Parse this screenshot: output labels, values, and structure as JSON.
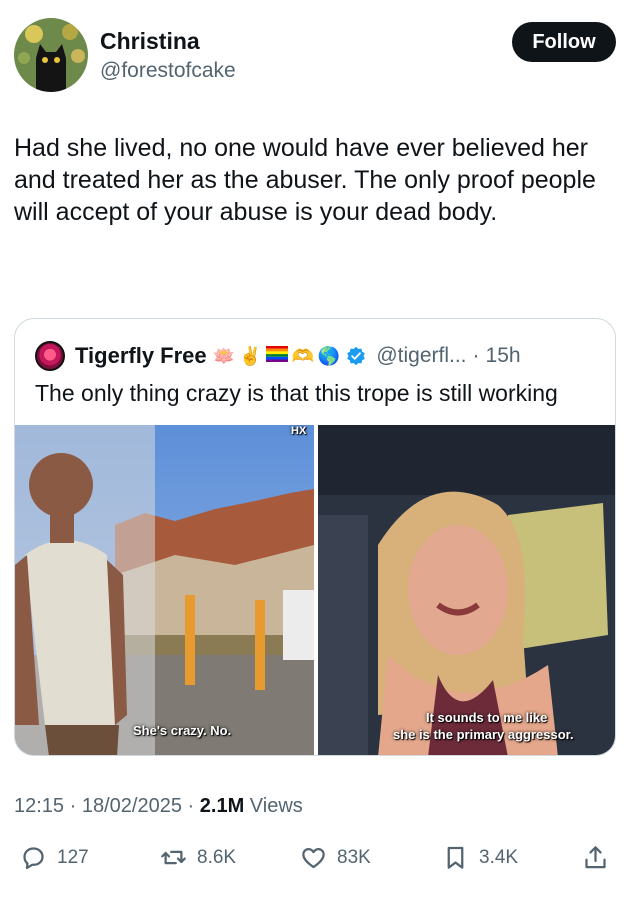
{
  "author": {
    "name": "Christina",
    "handle": "@forestofcake",
    "follow_label": "Follow"
  },
  "tweet": {
    "text": "Had she lived, no one would have ever believed her and treated her as the abuser. The only proof people will accept of your abuse is your dead body."
  },
  "quoted": {
    "name": "Tigerfly Free",
    "emojis": [
      "lotus-emoji",
      "victory-hand-emoji",
      "rainbow-flag-emoji",
      "heart-hands-emoji",
      "globe-emoji"
    ],
    "handle": "@tigerfl...",
    "separator": "·",
    "time": "15h",
    "text": "The only thing crazy is that this trope is still working",
    "media": [
      {
        "caption": "She's crazy. No.",
        "watermark": "HX"
      },
      {
        "caption_line1": "It sounds to me like",
        "caption_line2": "she is the primary aggressor."
      }
    ]
  },
  "meta": {
    "time": "12:15",
    "dot1": "·",
    "date": "18/02/2025",
    "dot2": "·",
    "views": "2.1M",
    "views_label": "Views"
  },
  "actions": {
    "replies": "127",
    "reposts": "8.6K",
    "likes": "83K",
    "bookmarks": "3.4K"
  },
  "colors": {
    "text": "#0f1419",
    "secondary": "#536471",
    "verified": "#1d9bf0",
    "border": "#cfd9de"
  }
}
